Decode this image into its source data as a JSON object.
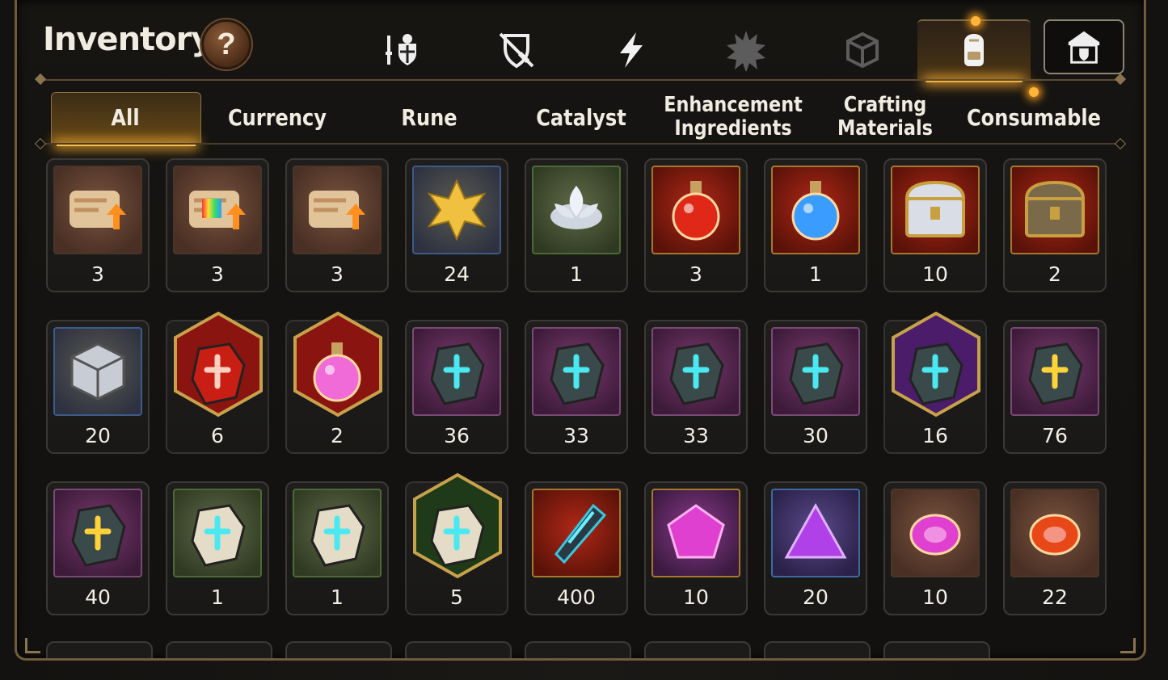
{
  "header": {
    "title": "Inventory",
    "help_label": "?"
  },
  "categories": [
    {
      "name": "equipment-icon",
      "active": false
    },
    {
      "name": "no-weapon-shield-icon",
      "active": false
    },
    {
      "name": "lightning-icon",
      "active": false
    },
    {
      "name": "shattered-burst-icon",
      "active": false
    },
    {
      "name": "cube-icon",
      "active": false
    },
    {
      "name": "backpack-icon",
      "active": true
    },
    {
      "name": "guild-armory-icon",
      "active": false
    }
  ],
  "tabs": [
    {
      "label": "All",
      "active": true
    },
    {
      "label": "Currency",
      "active": false
    },
    {
      "label": "Rune",
      "active": false
    },
    {
      "label": "Catalyst",
      "active": false
    },
    {
      "label": "Enhancement Ingredients",
      "lines": [
        "Enhancement",
        "Ingredients"
      ],
      "active": false
    },
    {
      "label": "Crafting Materials",
      "lines": [
        "Crafting",
        "Materials"
      ],
      "active": false
    },
    {
      "label": "Consumable",
      "active": false
    }
  ],
  "items": [
    {
      "count": "3",
      "icon": "scroll-upgrade-orange-icon",
      "bg": "brown"
    },
    {
      "count": "3",
      "icon": "scroll-upgrade-rainbow-icon",
      "bg": "brown"
    },
    {
      "count": "3",
      "icon": "scroll-upgrade-gold-icon",
      "bg": "brown"
    },
    {
      "count": "24",
      "icon": "gold-flower-crystal-icon",
      "bg": "blue"
    },
    {
      "count": "1",
      "icon": "silver-lotus-icon",
      "bg": "green"
    },
    {
      "count": "3",
      "icon": "red-potion-icon",
      "bg": "red"
    },
    {
      "count": "1",
      "icon": "blue-star-potion-icon",
      "bg": "red"
    },
    {
      "count": "10",
      "icon": "silver-chest-icon",
      "bg": "red"
    },
    {
      "count": "2",
      "icon": "gold-chest-icon",
      "bg": "red"
    },
    {
      "count": "20",
      "icon": "silver-cube-icon",
      "bg": "blue"
    },
    {
      "count": "6",
      "icon": "red-crystal-rune-icon",
      "bg": "hex-red"
    },
    {
      "count": "2",
      "icon": "pink-potion-chain-icon",
      "bg": "hex-red"
    },
    {
      "count": "36",
      "icon": "rune-stone-sword-icon",
      "bg": "purple"
    },
    {
      "count": "33",
      "icon": "rune-stone-spiral-icon",
      "bg": "purple"
    },
    {
      "count": "33",
      "icon": "rune-stone-armor-icon",
      "bg": "purple"
    },
    {
      "count": "30",
      "icon": "rune-stone-boot-icon",
      "bg": "purple"
    },
    {
      "count": "16",
      "icon": "rune-stone-star-icon",
      "bg": "hex-purple"
    },
    {
      "count": "76",
      "icon": "rune-stone-hammer-icon",
      "bg": "purple"
    },
    {
      "count": "40",
      "icon": "rune-stone-bolt-icon",
      "bg": "purple"
    },
    {
      "count": "1",
      "icon": "pale-rune-sword-icon",
      "bg": "green"
    },
    {
      "count": "1",
      "icon": "pale-rune-armor-icon",
      "bg": "green"
    },
    {
      "count": "5",
      "icon": "pale-rune-star-icon",
      "bg": "hex-green"
    },
    {
      "count": "400",
      "icon": "crystal-shard-icon",
      "bg": "red"
    },
    {
      "count": "10",
      "icon": "pink-gem-pentagon-icon",
      "bg": "pink"
    },
    {
      "count": "20",
      "icon": "purple-gem-triangle-icon",
      "bg": "bluepurple"
    },
    {
      "count": "10",
      "icon": "pink-gem-oval-icon",
      "bg": "brown"
    },
    {
      "count": "22",
      "icon": "red-gem-oval-icon",
      "bg": "brown"
    }
  ],
  "colors": {
    "accent": "#f2b13c",
    "panel_border": "#6f5c3c",
    "text": "#f1ece1"
  }
}
